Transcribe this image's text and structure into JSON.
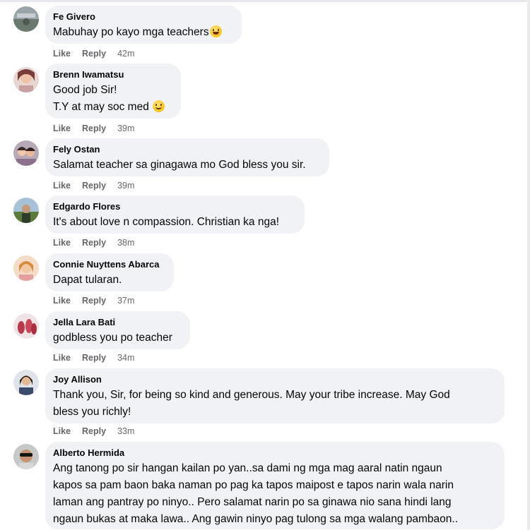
{
  "comments": [
    {
      "author": "Fe Givero",
      "text": "Mabuhay po kayo mga teachers",
      "emoji": "grin-emoji",
      "like": "Like",
      "reply": "Reply",
      "time": "42m"
    },
    {
      "author": "Brenn Iwamatsu",
      "text": "Good job Sir!\nT.Y at may soc med ",
      "emoji": "smile-emoji",
      "like": "Like",
      "reply": "Reply",
      "time": "39m"
    },
    {
      "author": "Fely Ostan",
      "text": "Salamat teacher sa ginagawa mo God bless you sir.",
      "like": "Like",
      "reply": "Reply",
      "time": "39m"
    },
    {
      "author": "Edgardo Flores",
      "text": "It's about love n compassion. Christian ka nga!",
      "like": "Like",
      "reply": "Reply",
      "time": "38m"
    },
    {
      "author": "Connie Nuyttens Abarca",
      "text": "Dapat tularan.",
      "like": "Like",
      "reply": "Reply",
      "time": "37m"
    },
    {
      "author": "Jella Lara Bati",
      "text": "godbless you po teacher",
      "like": "Like",
      "reply": "Reply",
      "time": "34m"
    },
    {
      "author": "Joy Allison",
      "text": "Thank you, Sir, for being so kind and generous. May your tribe increase. May God\nbless you richly!",
      "like": "Like",
      "reply": "Reply",
      "time": "33m"
    },
    {
      "author": "Alberto Hermida",
      "text": "Ang tanong po sir hangan kailan po yan..sa dami ng mga mag aaral natin ngaun\nkapos sa pam baon baka naman po pag ka tapos maipost e tapos narin wala narin\nlaman ang pantray po ninyo.. Pero salamat narin po sa ginawa nio sana hindi lang\nngaun bukas at maka lawa.. Ang gawin ninyo pag tulong sa mga walang pambaon.."
    }
  ],
  "colors": {
    "bubble": "#f0f2f5",
    "meta": "#65676b",
    "text": "#050505"
  }
}
